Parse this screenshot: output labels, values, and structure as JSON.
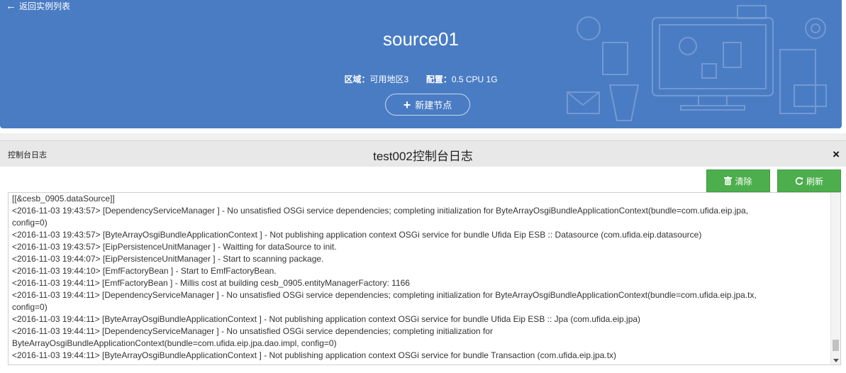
{
  "header": {
    "back_label": "返回实例列表",
    "title": "source01",
    "region_label": "区域：",
    "region_value": "可用地区3",
    "config_label": "配置：",
    "config_value": "0.5 CPU 1G",
    "new_node_label": "新建节点"
  },
  "panel": {
    "tag": "控制台日志",
    "title": "test002控制台日志",
    "close": "×",
    "clear_label": "清除",
    "refresh_label": "刷新"
  },
  "log": {
    "lines": [
      "[[&cesb_0905.dataSource]]",
      "<2016-11-03 19:43:57> [DependencyServiceManager ] - No unsatisfied OSGi service dependencies; completing initialization for ByteArrayOsgiBundleApplicationContext(bundle=com.ufida.eip.jpa,",
      "config=0)",
      "<2016-11-03 19:43:57> [ByteArrayOsgiBundleApplicationContext ] - Not publishing application context OSGi service for bundle Ufida Eip ESB :: Datasource (com.ufida.eip.datasource)",
      "<2016-11-03 19:43:57> [EipPersistenceUnitManager ] - Waitting for dataSource to init.",
      "<2016-11-03 19:44:07> [EipPersistenceUnitManager ] - Start to scanning package.",
      "<2016-11-03 19:44:10> [EmfFactoryBean ] - Start to EmfFactoryBean.",
      "<2016-11-03 19:44:11> [EmfFactoryBean ] - Millis cost at building cesb_0905.entityManagerFactory: 1166",
      "<2016-11-03 19:44:11> [DependencyServiceManager ] - No unsatisfied OSGi service dependencies; completing initialization for ByteArrayOsgiBundleApplicationContext(bundle=com.ufida.eip.jpa.tx,",
      "config=0)",
      "<2016-11-03 19:44:11> [ByteArrayOsgiBundleApplicationContext ] - Not publishing application context OSGi service for bundle Ufida Eip ESB :: Jpa (com.ufida.eip.jpa)",
      "<2016-11-03 19:44:11> [DependencyServiceManager ] - No unsatisfied OSGi service dependencies; completing initialization for",
      "ByteArrayOsgiBundleApplicationContext(bundle=com.ufida.eip.jpa.dao.impl, config=0)",
      "<2016-11-03 19:44:11> [ByteArrayOsgiBundleApplicationContext ] - Not publishing application context OSGi service for bundle Transaction (com.ufida.eip.jpa.tx)"
    ]
  },
  "icons": {
    "back": "arrow-left-icon",
    "plus": "plus-icon",
    "close": "close-icon",
    "trash": "trash-icon",
    "refresh": "refresh-icon"
  },
  "colors": {
    "header_bg": "#4a7cc4",
    "button_green": "#4cae4c"
  }
}
